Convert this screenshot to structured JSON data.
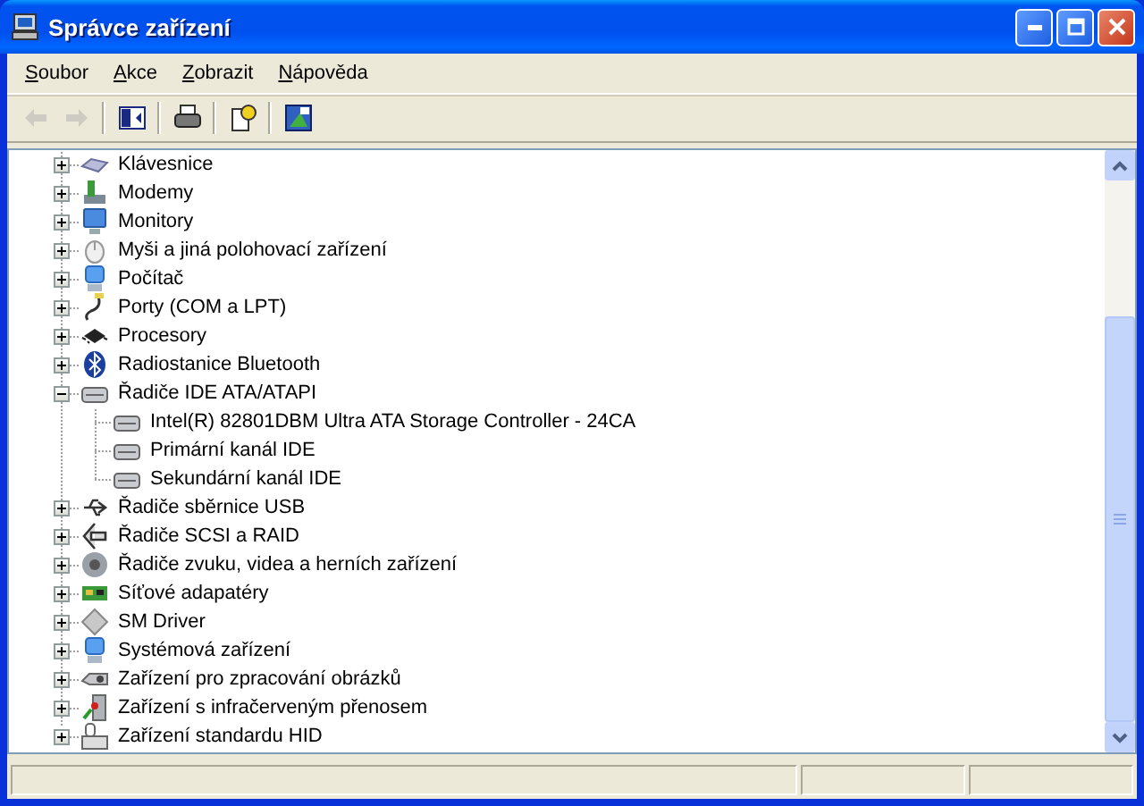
{
  "window": {
    "title": "Správce zařízení"
  },
  "menu": [
    {
      "label": "Soubor"
    },
    {
      "label": "Akce"
    },
    {
      "label": "Zobrazit"
    },
    {
      "label": "Nápověda"
    }
  ],
  "toolbar": [
    {
      "kind": "back",
      "disabled": true
    },
    {
      "kind": "forward",
      "disabled": true
    },
    {
      "kind": "separator"
    },
    {
      "kind": "tree-pane",
      "disabled": false
    },
    {
      "kind": "separator"
    },
    {
      "kind": "print",
      "disabled": false
    },
    {
      "kind": "separator"
    },
    {
      "kind": "help",
      "disabled": false
    },
    {
      "kind": "separator"
    },
    {
      "kind": "properties",
      "disabled": false
    }
  ],
  "tree": [
    {
      "label": "Klávesnice",
      "kind": "keyboard",
      "expanded": false
    },
    {
      "label": "Modemy",
      "kind": "modem",
      "expanded": false
    },
    {
      "label": "Monitory",
      "kind": "monitor",
      "expanded": false
    },
    {
      "label": "Myši a jiná polohovací zařízení",
      "kind": "mouse",
      "expanded": false
    },
    {
      "label": "Počítač",
      "kind": "computer",
      "expanded": false
    },
    {
      "label": "Porty (COM a LPT)",
      "kind": "port",
      "expanded": false
    },
    {
      "label": "Procesory",
      "kind": "chip",
      "expanded": false
    },
    {
      "label": "Radiostanice Bluetooth",
      "kind": "bluetooth",
      "expanded": false
    },
    {
      "label": "Řadiče IDE ATA/ATAPI",
      "kind": "drive",
      "expanded": true,
      "children": [
        {
          "label": "Intel(R) 82801DBM Ultra ATA Storage Controller - 24CA",
          "kind": "drive"
        },
        {
          "label": "Primární kanál IDE",
          "kind": "drive"
        },
        {
          "label": "Sekundární kanál IDE",
          "kind": "drive"
        }
      ]
    },
    {
      "label": "Řadiče sběrnice USB",
      "kind": "usb",
      "expanded": false
    },
    {
      "label": "Řadiče SCSI a RAID",
      "kind": "scsi",
      "expanded": false
    },
    {
      "label": "Řadiče zvuku, videa a herních zařízení",
      "kind": "speaker",
      "expanded": false
    },
    {
      "label": "Síťové adapatéry",
      "kind": "network",
      "expanded": false
    },
    {
      "label": "SM Driver",
      "kind": "diamond",
      "expanded": false
    },
    {
      "label": "Systémová zařízení",
      "kind": "computer",
      "expanded": false
    },
    {
      "label": "Zařízení pro zpracování obrázků",
      "kind": "camera",
      "expanded": false
    },
    {
      "label": "Zařízení s infračerveným přenosem",
      "kind": "infrared",
      "expanded": false
    },
    {
      "label": "Zařízení standardu HID",
      "kind": "hid",
      "expanded": false
    }
  ]
}
